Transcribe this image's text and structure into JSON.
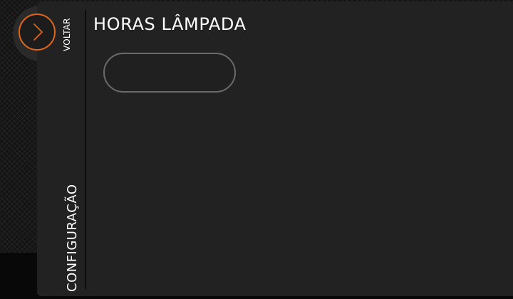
{
  "nav": {
    "back_label": "VOLTAR",
    "section_label": "CONFIGURAÇÃO"
  },
  "page": {
    "title": "HORAS LÂMPADA",
    "value": ""
  },
  "icons": {
    "back": "chevron-right-icon"
  },
  "colors": {
    "accent": "#e0661b",
    "panel": "#222222",
    "text": "#ffffff",
    "field_border": "#6a6a6a"
  }
}
